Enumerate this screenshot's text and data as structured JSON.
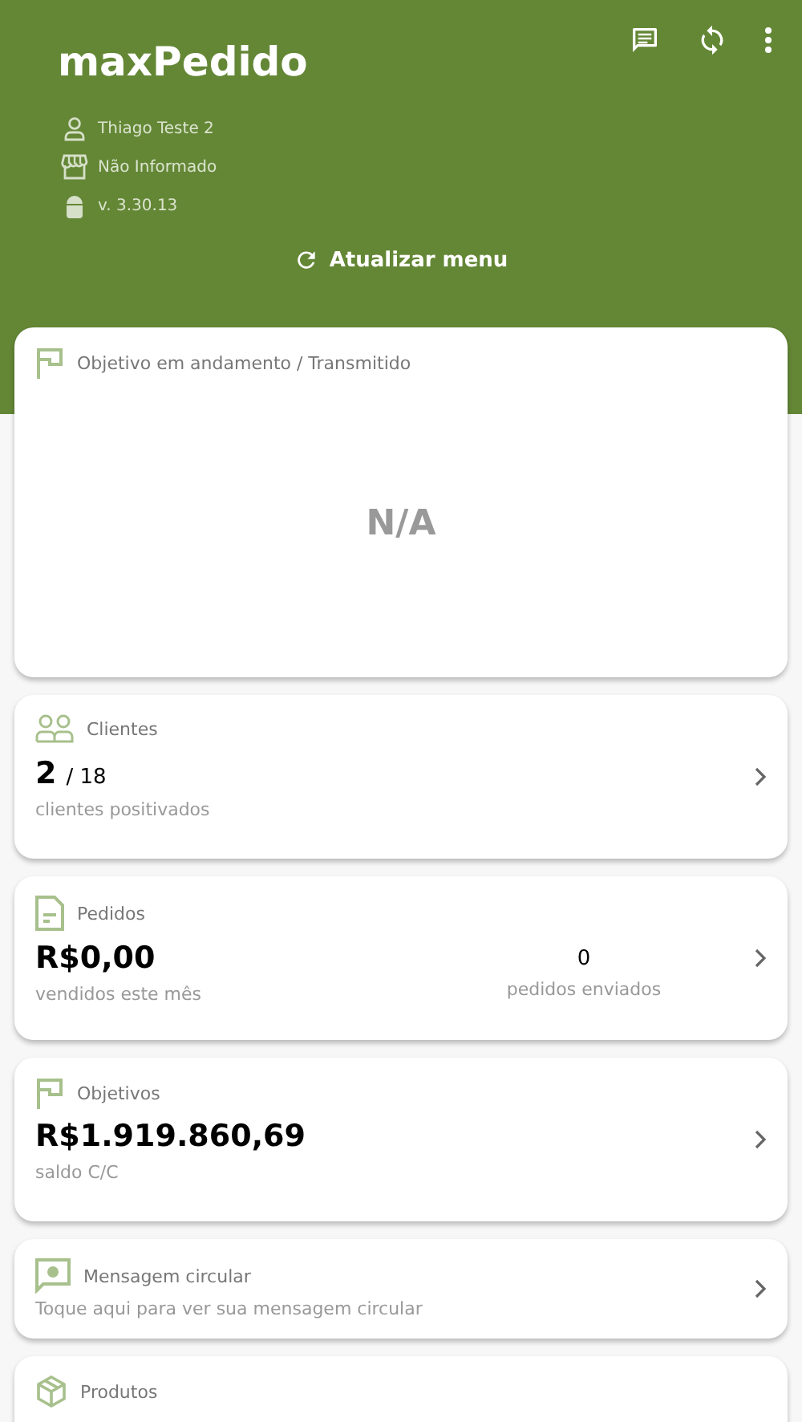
{
  "header": {
    "title": "maxPedido",
    "user": "Thiago Teste 2",
    "store": "Não Informado",
    "version": "v. 3.30.13",
    "refresh_label": "Atualizar menu"
  },
  "cards": [
    {
      "kind": "objective",
      "title": "Objetivo em andamento / Transmitido",
      "value": "N/A"
    },
    {
      "kind": "count",
      "title": "Clientes",
      "value": "2",
      "total": "/ 18",
      "caption": "clientes positivados"
    },
    {
      "kind": "dual",
      "title": "Pedidos",
      "value": "R$0,00",
      "caption": "vendidos este mês",
      "value_2": "0",
      "caption_2": "pedidos enviados"
    },
    {
      "kind": "value",
      "title": "Objetivos",
      "value": "R$1.919.860,69",
      "caption": "saldo C/C"
    },
    {
      "kind": "message",
      "title": "Mensagem circular",
      "caption": "Toque aqui para ver sua mensagem circular"
    },
    {
      "kind": "partial",
      "title": "Produtos"
    }
  ]
}
